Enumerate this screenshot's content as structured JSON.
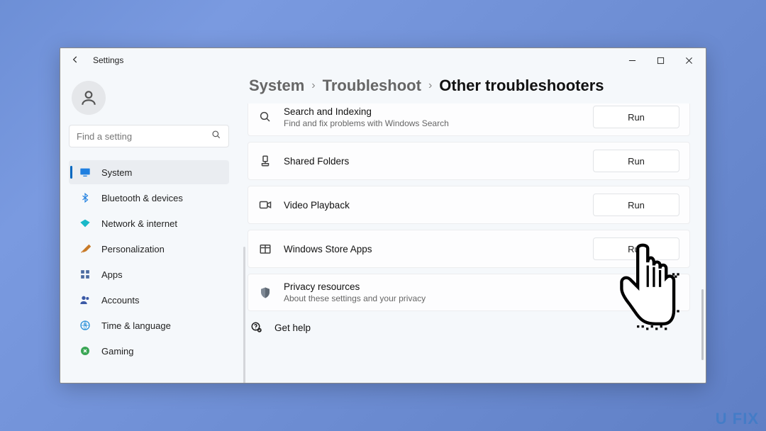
{
  "titlebar": {
    "app_name": "Settings"
  },
  "search": {
    "placeholder": "Find a setting"
  },
  "sidebar": {
    "items": [
      {
        "label": "System",
        "icon": "monitor",
        "color": "#1f7fe0",
        "active": true
      },
      {
        "label": "Bluetooth & devices",
        "icon": "bluetooth",
        "color": "#1f7fe0"
      },
      {
        "label": "Network & internet",
        "icon": "wifi",
        "color": "#19b8c8"
      },
      {
        "label": "Personalization",
        "icon": "brush",
        "color": "#c87a28"
      },
      {
        "label": "Apps",
        "icon": "apps",
        "color": "#4a6aa0"
      },
      {
        "label": "Accounts",
        "icon": "accounts",
        "color": "#3c5aa6"
      },
      {
        "label": "Time & language",
        "icon": "clock",
        "color": "#2c91d9"
      },
      {
        "label": "Gaming",
        "icon": "gaming",
        "color": "#3aa655"
      }
    ]
  },
  "breadcrumb": {
    "items": [
      "System",
      "Troubleshoot",
      "Other troubleshooters"
    ]
  },
  "cards": [
    {
      "title": "Search and Indexing",
      "subtitle": "Find and fix problems with Windows Search",
      "icon": "search",
      "run": "Run"
    },
    {
      "title": "Shared Folders",
      "icon": "shared-folder",
      "run": "Run"
    },
    {
      "title": "Video Playback",
      "icon": "video",
      "run": "Run"
    },
    {
      "title": "Windows Store Apps",
      "icon": "store",
      "run": "Run"
    },
    {
      "title": "Privacy resources",
      "subtitle": "About these settings and your privacy",
      "icon": "shield"
    }
  ],
  "help": {
    "label": "Get help"
  },
  "watermark": "U    FIX"
}
